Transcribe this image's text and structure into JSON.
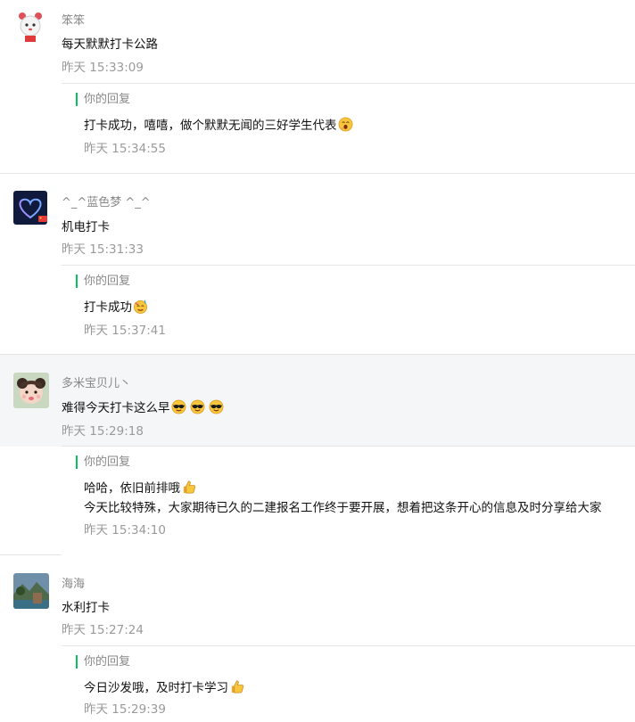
{
  "reply_label": "你的回复",
  "accent_color": "#07c160",
  "comments": [
    {
      "name": "笨笨",
      "avatar": "cartoon-girl-avatar",
      "content": "每天默默打卡公路",
      "time": "昨天 15:33:09",
      "reply": {
        "lines": [
          "打卡成功，嘻嘻，做个默默无闻的三好学生代表"
        ],
        "emojis": [
          "yawn-emoji"
        ],
        "time": "昨天 15:34:55"
      }
    },
    {
      "name": "^_^蓝色梦 ^_^",
      "avatar": "blue-heart-avatar",
      "content": "机电打卡",
      "time": "昨天 15:31:33",
      "reply": {
        "lines": [
          "打卡成功"
        ],
        "emojis": [
          "party-emoji"
        ],
        "time": "昨天 15:37:41"
      }
    },
    {
      "name": "多米宝贝儿丶",
      "avatar": "baby-avatar",
      "content": "难得今天打卡这么早",
      "content_emojis": [
        "sunglasses-emoji",
        "sunglasses-emoji",
        "sunglasses-emoji"
      ],
      "time": "昨天 15:29:18",
      "reply": {
        "lines": [
          "哈哈，依旧前排哦",
          "今天比较特殊，大家期待已久的二建报名工作终于要开展，想着把这条开心的信息及时分享给大家"
        ],
        "emojis": [
          "thumbs-up-emoji"
        ],
        "time": "昨天 15:34:10"
      }
    },
    {
      "name": "海海",
      "avatar": "landscape-avatar",
      "content": "水利打卡",
      "time": "昨天 15:27:24",
      "reply": {
        "lines": [
          "今日沙发哦，及时打卡学习"
        ],
        "emojis": [
          "thumbs-up-emoji"
        ],
        "time": "昨天 15:29:39"
      }
    }
  ]
}
